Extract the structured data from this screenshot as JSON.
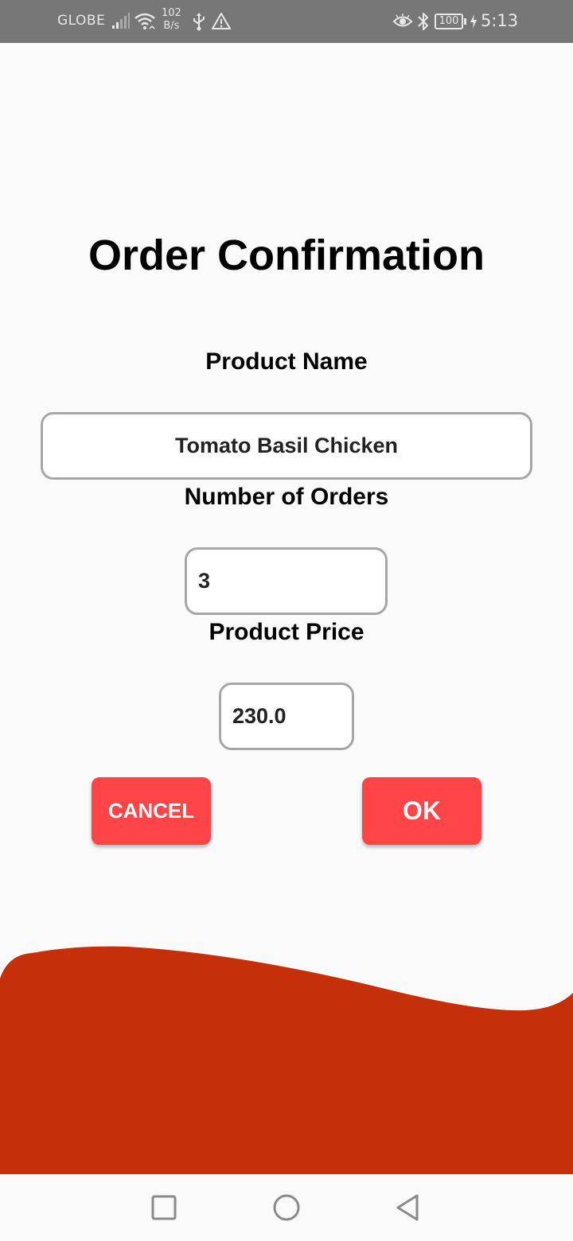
{
  "status_bar": {
    "carrier": "GLOBE",
    "net_speed_value": "102",
    "net_speed_unit": "B/s",
    "battery": "100",
    "time": "5:13",
    "icons": [
      "signal-icon",
      "wifi-icon",
      "usb-icon",
      "warning-icon",
      "eye-icon",
      "bluetooth-icon",
      "battery-icon",
      "charging-icon"
    ]
  },
  "page": {
    "title": "Order Confirmation"
  },
  "form": {
    "product_name_label": "Product Name",
    "product_name_value": "Tomato Basil Chicken",
    "orders_label": "Number of Orders",
    "orders_value": "3",
    "price_label": "Product Price",
    "price_value": "230.0"
  },
  "actions": {
    "cancel_label": "CANCEL",
    "ok_label": "OK"
  },
  "nav_bar": {
    "icons": [
      "recents-square-icon",
      "home-circle-icon",
      "back-triangle-icon"
    ]
  },
  "colors": {
    "status_bar": "#777777",
    "background": "#fafafa",
    "button": "#ff4548",
    "wave": "#c52f0a",
    "input_border": "#a6a6a6"
  }
}
